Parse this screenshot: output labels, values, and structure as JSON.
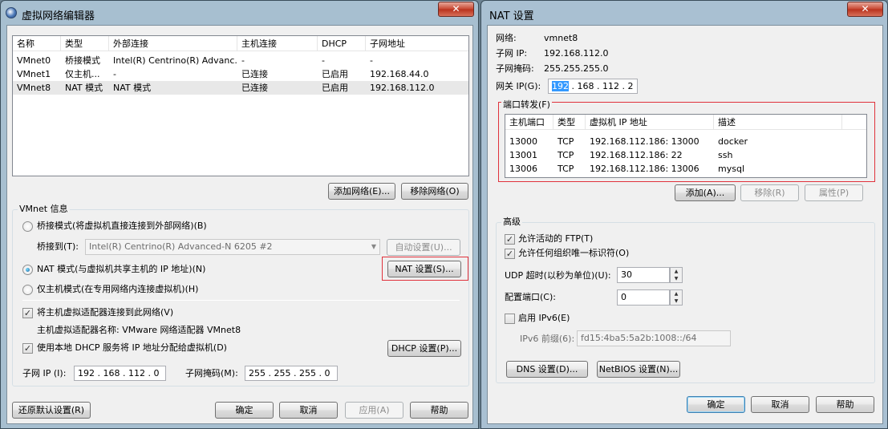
{
  "editor": {
    "title": "虚拟网络编辑器",
    "close_glyph": "✕",
    "table": {
      "headers": [
        "名称",
        "类型",
        "外部连接",
        "主机连接",
        "DHCP",
        "子网地址"
      ],
      "rows": [
        [
          "VMnet0",
          "桥接模式",
          "Intel(R) Centrino(R) Advanc...",
          "-",
          "-",
          "-"
        ],
        [
          "VMnet1",
          "仅主机...",
          "-",
          "已连接",
          "已启用",
          "192.168.44.0"
        ],
        [
          "VMnet8",
          "NAT 模式",
          "NAT 模式",
          "已连接",
          "已启用",
          "192.168.112.0"
        ]
      ]
    },
    "add_network": "添加网络(E)...",
    "remove_network": "移除网络(O)",
    "vmnet_info_label": "VMnet 信息",
    "bridge_mode": "桥接模式(将虚拟机直接连接到外部网络)(B)",
    "bridge_to_label": "桥接到(T):",
    "bridge_to_value": "Intel(R) Centrino(R) Advanced-N 6205 #2",
    "auto_settings": "自动设置(U)...",
    "nat_mode": "NAT 模式(与虚拟机共享主机的 IP 地址)(N)",
    "nat_settings": "NAT 设置(S)...",
    "host_only_mode": "仅主机模式(在专用网络内连接虚拟机)(H)",
    "connect_adapter": "将主机虚拟适配器连接到此网络(V)",
    "adapter_name": "主机虚拟适配器名称: VMware 网络适配器 VMnet8",
    "use_dhcp": "使用本地 DHCP 服务将 IP 地址分配给虚拟机(D)",
    "dhcp_settings": "DHCP 设置(P)...",
    "subnet_ip_label": "子网 IP (I):",
    "subnet_ip_value": "192 . 168 . 112 . 0",
    "subnet_mask_label": "子网掩码(M):",
    "subnet_mask_value": "255 . 255 . 255 . 0",
    "restore_defaults": "还原默认设置(R)",
    "ok": "确定",
    "cancel": "取消",
    "apply": "应用(A)",
    "help": "帮助"
  },
  "nat": {
    "title": "NAT 设置",
    "close_glyph": "✕",
    "network_label": "网络:",
    "network_value": "vmnet8",
    "subnet_ip_label": "子网 IP:",
    "subnet_ip_value": "192.168.112.0",
    "subnet_mask_label": "子网掩码:",
    "subnet_mask_value": "255.255.255.0",
    "gateway_label": "网关 IP(G):",
    "gateway_first_octet": "192",
    "gateway_rest": " . 168 . 112 .  2",
    "port_forwarding_label": "端口转发(F)",
    "pf_headers": [
      "主机端口",
      "类型",
      "虚拟机 IP 地址",
      "描述"
    ],
    "pf_rows": [
      [
        "13000",
        "TCP",
        "192.168.112.186: 13000",
        "docker"
      ],
      [
        "13001",
        "TCP",
        "192.168.112.186: 22",
        "ssh"
      ],
      [
        "13006",
        "TCP",
        "192.168.112.186: 13006",
        "mysql"
      ]
    ],
    "add": "添加(A)...",
    "remove": "移除(R)",
    "properties": "属性(P)",
    "advanced_label": "高级",
    "allow_ftp": "允许活动的 FTP(T)",
    "allow_any_oui": "允许任何组织唯一标识符(O)",
    "udp_timeout_label": "UDP 超时(以秒为单位)(U):",
    "udp_timeout_value": "30",
    "config_port_label": "配置端口(C):",
    "config_port_value": "0",
    "enable_ipv6": "启用 IPv6(E)",
    "ipv6_prefix_label": "IPv6 前缀(6):",
    "ipv6_prefix_value": "fd15:4ba5:5a2b:1008::/64",
    "dns_settings": "DNS 设置(D)...",
    "netbios_settings": "NetBIOS 设置(N)...",
    "ok": "确定",
    "cancel": "取消",
    "help": "帮助"
  },
  "colors": {
    "highlight_box": "#e0323c",
    "selection": "#3399ff",
    "frame": "#a7bfd0"
  }
}
